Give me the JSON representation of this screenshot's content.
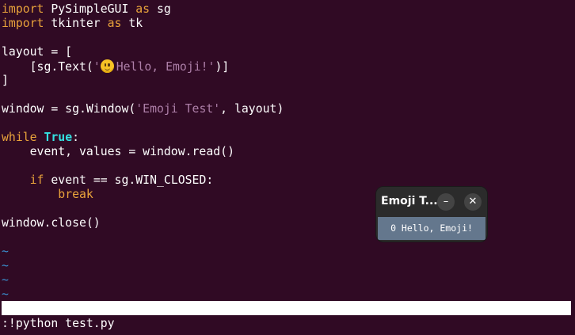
{
  "editor": {
    "line1": {
      "kw1": "import",
      "mod": " PySimpleGUI ",
      "kw2": "as",
      "alias": " sg"
    },
    "line2": {
      "kw1": "import",
      "mod": " tkinter ",
      "kw2": "as",
      "alias": " tk"
    },
    "line4": "layout = [",
    "line5": {
      "pre": "    [sg.Text(",
      "str_open": "'",
      "str_text": "Hello, Emoji!'",
      "post": ")]"
    },
    "line6": "]",
    "line8": {
      "pre": "window = sg.Window(",
      "str": "'Emoji Test'",
      "post": ", layout)"
    },
    "line10": {
      "kw": "while",
      "space": " ",
      "const": "True",
      "post": ":"
    },
    "line11": "    event, values = window.read()",
    "line13": {
      "indent": "    ",
      "kw": "if",
      "post": " event == sg.WIN_CLOSED:"
    },
    "line14": {
      "indent": "        ",
      "kw": "break"
    },
    "line16": "window.close()",
    "tilde": "~",
    "cmdline": ":!python test.py"
  },
  "popup": {
    "title": "Emoji T...",
    "minimize_glyph": "–",
    "close_glyph": "✕",
    "text": "0 Hello, Emoji!",
    "content_bg": "#64778d"
  },
  "colors": {
    "background": "#300a24",
    "keyword": "#e9a33b",
    "string": "#ad7fa8",
    "constant": "#34e2e2",
    "tilde": "#3a8fcf"
  }
}
